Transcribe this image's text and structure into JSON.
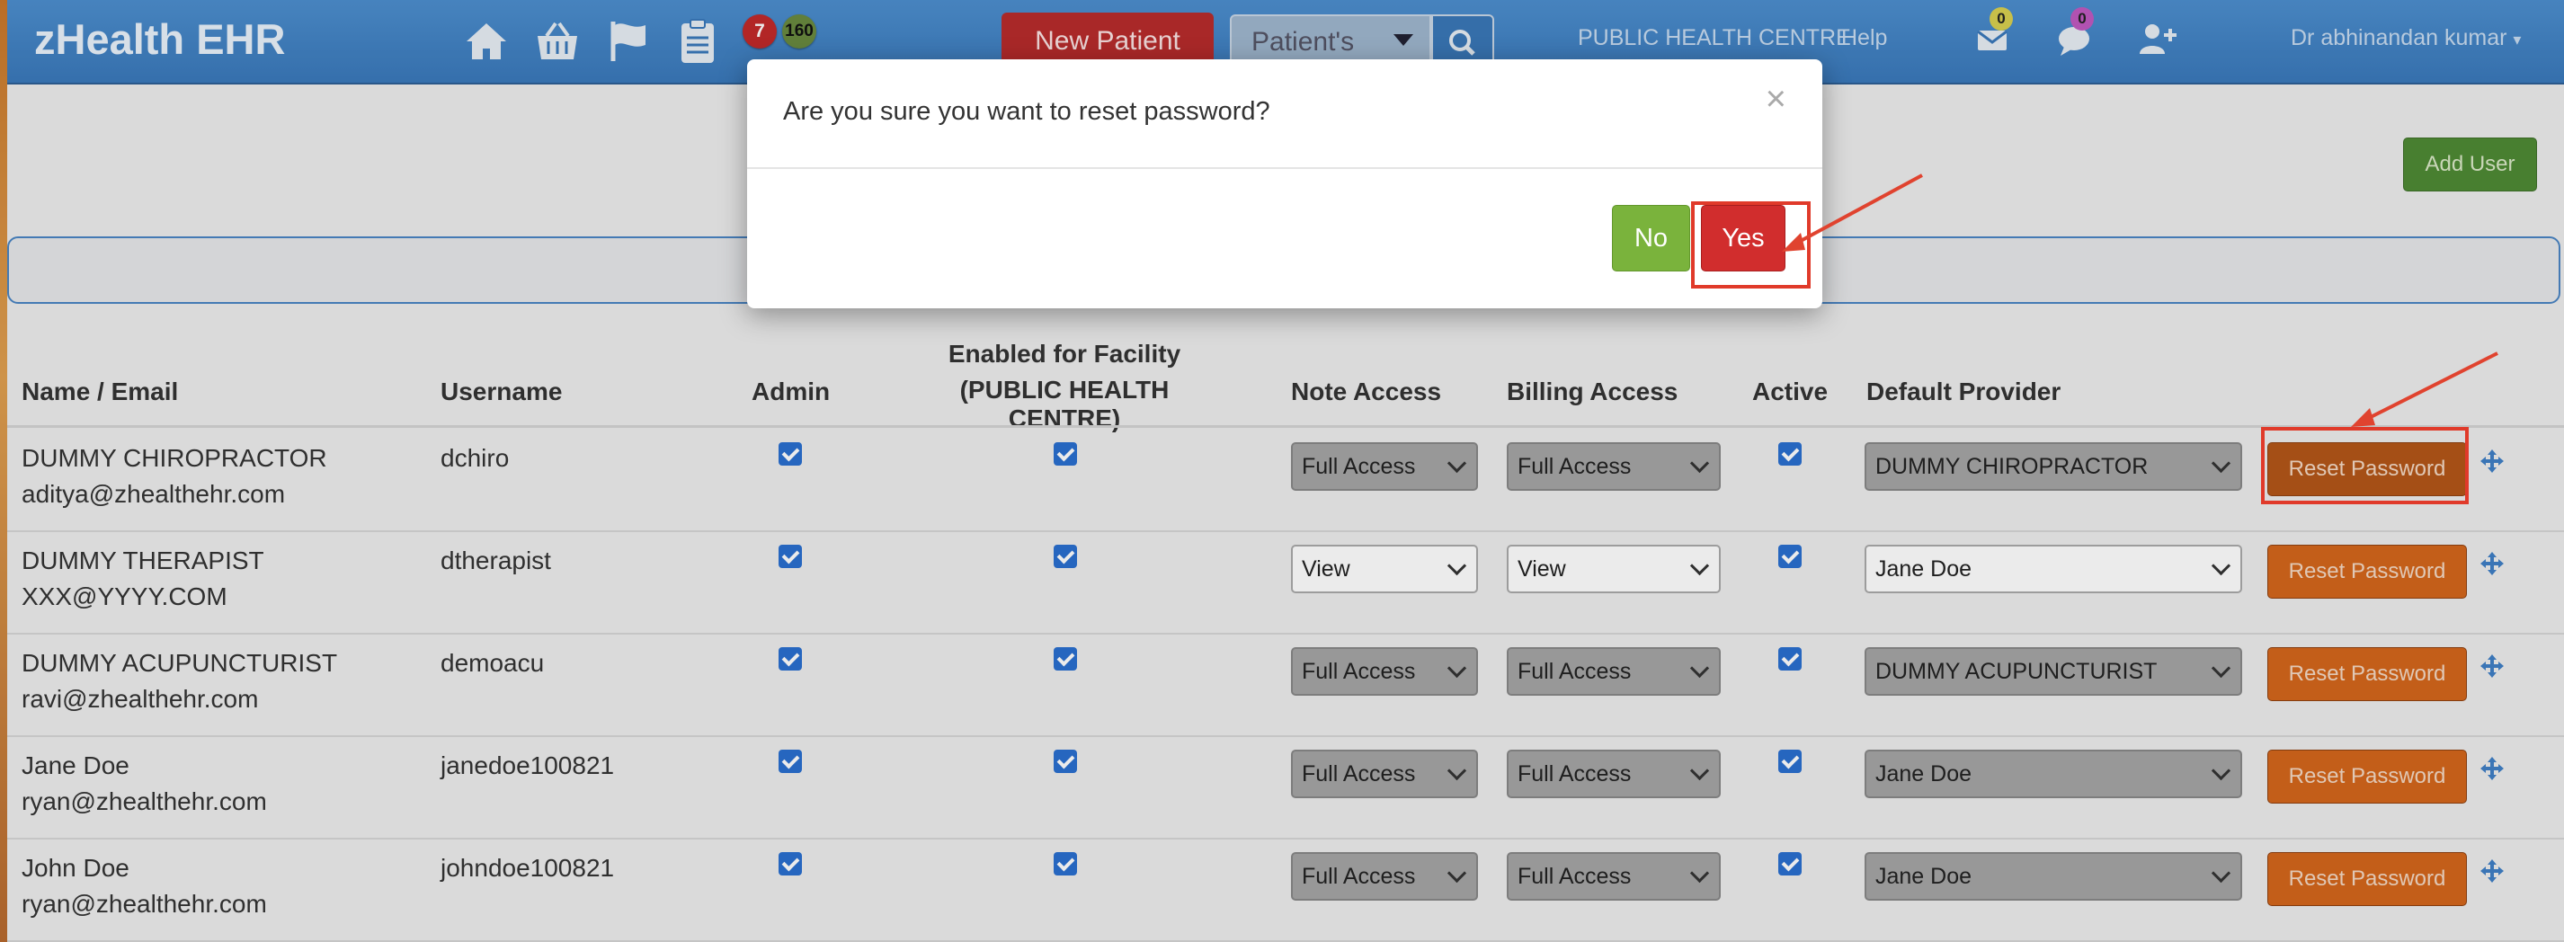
{
  "app": {
    "brand": "zHealth EHR"
  },
  "nav": {
    "badge_alerts": "7",
    "badge_tasks": "160",
    "new_patient": "New Patient",
    "patient_select": "Patient's",
    "facility": "PUBLIC HEALTH CENTRE",
    "help": "Help",
    "mail_count": "0",
    "chat_count": "0",
    "user": "Dr abhinandan kumar"
  },
  "toolbar": {
    "add_user": "Add User"
  },
  "table": {
    "headers": {
      "name": "Name / Email",
      "username": "Username",
      "admin": "Admin",
      "facility_line1": "Enabled for Facility",
      "facility_line2": "(PUBLIC HEALTH CENTRE)",
      "note": "Note Access",
      "billing": "Billing Access",
      "active": "Active",
      "provider": "Default Provider"
    },
    "rows": [
      {
        "name": "DUMMY CHIROPRACTOR",
        "email": "aditya@zhealthehr.com",
        "username": "dchiro",
        "note": "Full Access",
        "billing": "Full Access",
        "provider": "DUMMY CHIROPRACTOR",
        "reset": "Reset Password"
      },
      {
        "name": "DUMMY THERAPIST",
        "email": "XXX@YYYY.COM",
        "username": "dtherapist",
        "note": "View",
        "billing": "View",
        "provider": "Jane Doe",
        "reset": "Reset Password"
      },
      {
        "name": "DUMMY ACUPUNCTURIST",
        "email": "ravi@zhealthehr.com",
        "username": "demoacu",
        "note": "Full Access",
        "billing": "Full Access",
        "provider": "DUMMY ACUPUNCTURIST",
        "reset": "Reset Password"
      },
      {
        "name": "Jane Doe",
        "email": "ryan@zhealthehr.com",
        "username": "janedoe100821",
        "note": "Full Access",
        "billing": "Full Access",
        "provider": "Jane Doe",
        "reset": "Reset Password"
      },
      {
        "name": "John Doe",
        "email": "ryan@zhealthehr.com",
        "username": "johndoe100821",
        "note": "Full Access",
        "billing": "Full Access",
        "provider": "Jane Doe",
        "reset": "Reset Password"
      }
    ]
  },
  "modal": {
    "title": "Are you sure you want to reset password?",
    "close": "×",
    "no": "No",
    "yes": "Yes"
  },
  "colors": {
    "navbar": "#3a79bb",
    "new_patient": "#b82c2c",
    "add_user": "#4f8a35",
    "reset_button": "#b35618",
    "yes_button": "#d12d2d",
    "no_button": "#7ab33c",
    "highlight": "#e03a2a"
  }
}
